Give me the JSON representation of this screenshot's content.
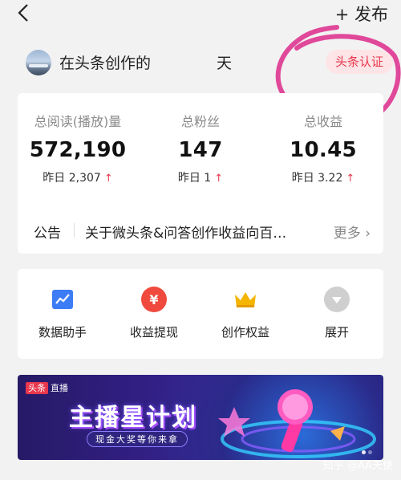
{
  "header": {
    "publish_label": "+ 发布"
  },
  "user": {
    "name": "在头条创作的",
    "name_tail": "天",
    "badge": "头条认证"
  },
  "stats": [
    {
      "label": "总阅读(播放)量",
      "value": "572,190",
      "sub": "昨日 2,307"
    },
    {
      "label": "总粉丝",
      "value": "147",
      "sub": "昨日 1"
    },
    {
      "label": "总收益",
      "value": "10.45",
      "sub": "昨日 3.22"
    }
  ],
  "trend_icon": "up-arrow-icon",
  "notice": {
    "label": "公告",
    "text": "关于微头条&问答创作收益向百…",
    "more": "更多"
  },
  "tools": [
    {
      "label": "数据助手",
      "icon": "chart-icon",
      "color": "#3c7cf5"
    },
    {
      "label": "收益提现",
      "icon": "yen-icon",
      "color": "#f04a3e"
    },
    {
      "label": "创作权益",
      "icon": "crown-icon",
      "color": "#f5b400"
    },
    {
      "label": "展开",
      "icon": "expand-icon",
      "color": "#cfcfcf"
    }
  ],
  "banner": {
    "tag_brand": "头条",
    "tag_text": "直播",
    "title": "主播星计划",
    "subtitle": "现金大奖等你来拿"
  },
  "watermark": "知乎 @AA天使",
  "colors": {
    "accent": "#e8374d",
    "annotation": "#e0489a"
  }
}
